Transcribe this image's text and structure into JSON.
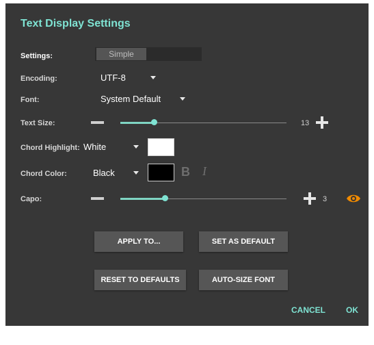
{
  "dialog": {
    "title": "Text Display Settings",
    "settings": {
      "label": "Settings:",
      "option_selected": "Simple"
    },
    "encoding": {
      "label": "Encoding:",
      "value": "UTF-8"
    },
    "font": {
      "label": "Font:",
      "value": "System Default"
    },
    "text_size": {
      "label": "Text Size:",
      "value": "13",
      "level": 0.204
    },
    "chord_highlight": {
      "label": "Chord Highlight:",
      "value": "White",
      "swatch_color": "#ffffff"
    },
    "chord_color": {
      "label": "Chord Color:",
      "value": "Black",
      "swatch_color": "#000000",
      "bold_glyph": "B",
      "italic_glyph": "I"
    },
    "capo": {
      "label": "Capo:",
      "value": "3",
      "level": 0.27
    },
    "buttons": {
      "apply_to": "APPLY TO...",
      "set_as_default": "SET AS DEFAULT",
      "reset_to_defaults": "RESET TO DEFAULTS",
      "auto_size_font": "AUTO-SIZE FONT"
    },
    "actions": {
      "cancel": "CANCEL",
      "ok": "OK"
    },
    "icons": {
      "caret": "chevron-down-icon",
      "minus": "minus-icon",
      "plus": "plus-icon",
      "preview": "eye-icon"
    },
    "colors": {
      "accent": "#7fe3d3",
      "preview_icon": "#f08a00",
      "background": "#373737"
    }
  }
}
